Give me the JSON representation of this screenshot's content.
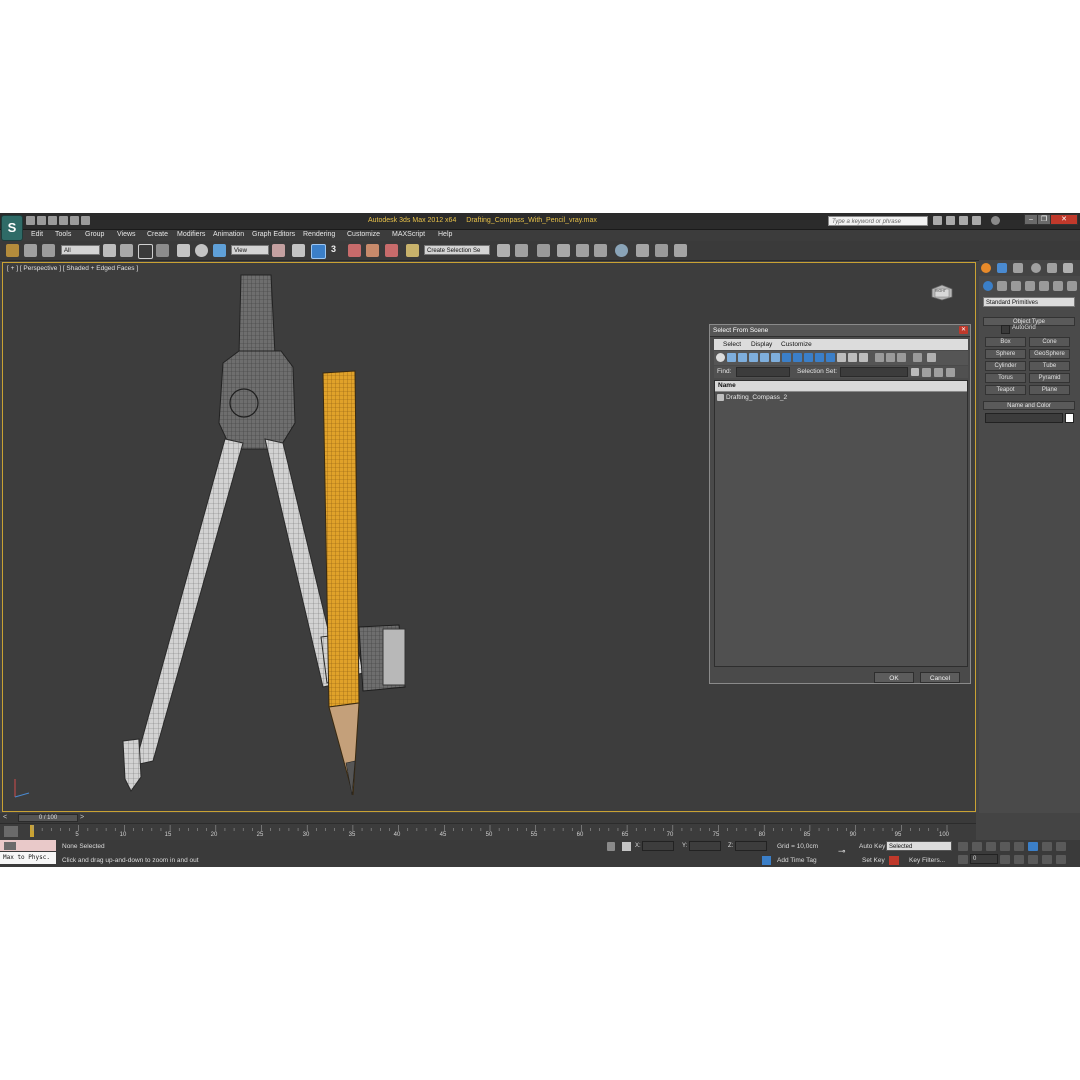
{
  "titlebar": {
    "app_title": "Autodesk 3ds Max  2012 x64",
    "file_name": "Drafting_Compass_With_Pencil_vray.max",
    "search_placeholder": "Type a keyword or phrase"
  },
  "menu": [
    "Edit",
    "Tools",
    "Group",
    "Views",
    "Create",
    "Modifiers",
    "Animation",
    "Graph Editors",
    "Rendering",
    "Customize",
    "MAXScript",
    "Help"
  ],
  "toolbar": {
    "selection_filter": "All",
    "ref_coord": "View",
    "snap_value": "3",
    "named_selection": "Create Selection Se"
  },
  "viewport": {
    "label": "[ + ] [ Perspective ] [ Shaded + Edged Faces ]",
    "viewcube_face": "RIGHT",
    "accent_border": "#c9a233",
    "pencil_color": "#e0a22a"
  },
  "select_dialog": {
    "title": "Select From Scene",
    "menu": [
      "Select",
      "Display",
      "Customize"
    ],
    "find_label": "Find:",
    "selection_set_label": "Selection Set:",
    "column_name": "Name",
    "items": [
      "Drafting_Compass_2"
    ],
    "ok": "OK",
    "cancel": "Cancel"
  },
  "command_panel": {
    "category": "Standard Primitives",
    "object_type_title": "Object Type",
    "autogrid": "AutoGrid",
    "primitives": [
      "Box",
      "Cone",
      "Sphere",
      "GeoSphere",
      "Cylinder",
      "Tube",
      "Torus",
      "Pyramid",
      "Teapot",
      "Plane"
    ],
    "name_color_title": "Name and Color"
  },
  "timeline": {
    "frame_display": "0 / 100",
    "ticks": [
      "5",
      "10",
      "15",
      "20",
      "25",
      "30",
      "35",
      "40",
      "45",
      "50",
      "55",
      "60",
      "65",
      "70",
      "75",
      "80",
      "85",
      "90",
      "95",
      "100"
    ]
  },
  "status": {
    "maxscript": "Max to Physc.",
    "selection": "None Selected",
    "prompt": "Click and drag up-and-down to zoom in and out",
    "x_label": "X:",
    "y_label": "Y:",
    "z_label": "Z:",
    "grid": "Grid = 10,0cm",
    "add_time_tag": "Add Time Tag",
    "auto_key": "Auto Key",
    "set_key": "Set Key",
    "key_mode": "Selected",
    "key_filters": "Key Filters...",
    "frame": "0"
  }
}
